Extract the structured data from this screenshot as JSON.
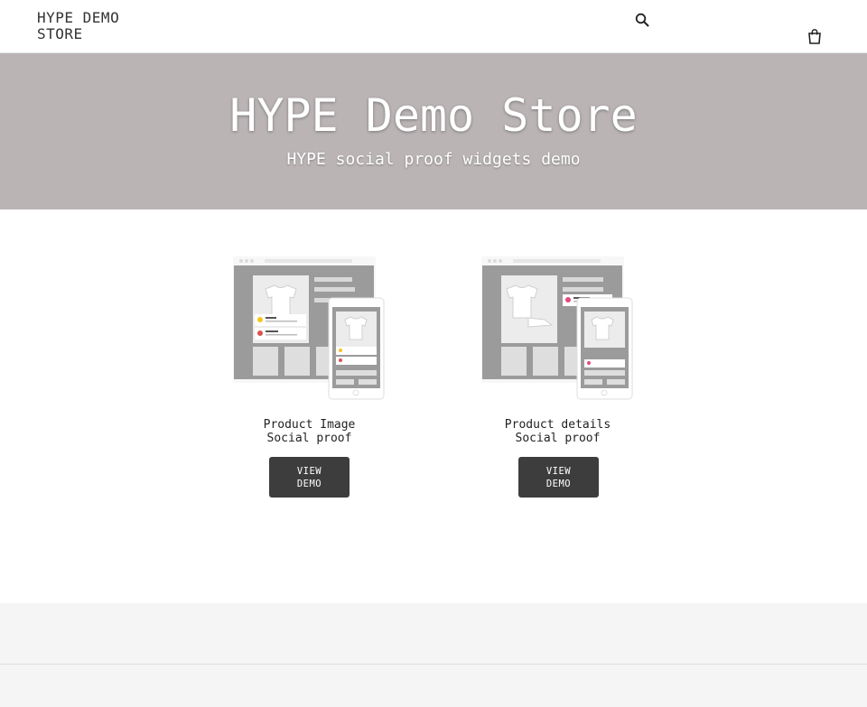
{
  "header": {
    "logo": "HYPE DEMO\nSTORE",
    "search_icon": "search-icon",
    "cart_icon": "cart-icon"
  },
  "hero": {
    "title": "HYPE Demo Store",
    "subtitle": "HYPE social proof widgets demo"
  },
  "products": [
    {
      "title": "Product Image\nSocial proof",
      "button": "VIEW\nDEMO",
      "image_icon": "product-image-illustration"
    },
    {
      "title": "Product details\nSocial proof",
      "button": "VIEW\nDEMO",
      "image_icon": "product-details-illustration"
    }
  ],
  "colors": {
    "hero_bg": "#bab4b5",
    "button_bg": "#3d3d3d",
    "footer_bg": "#f5f5f5"
  }
}
